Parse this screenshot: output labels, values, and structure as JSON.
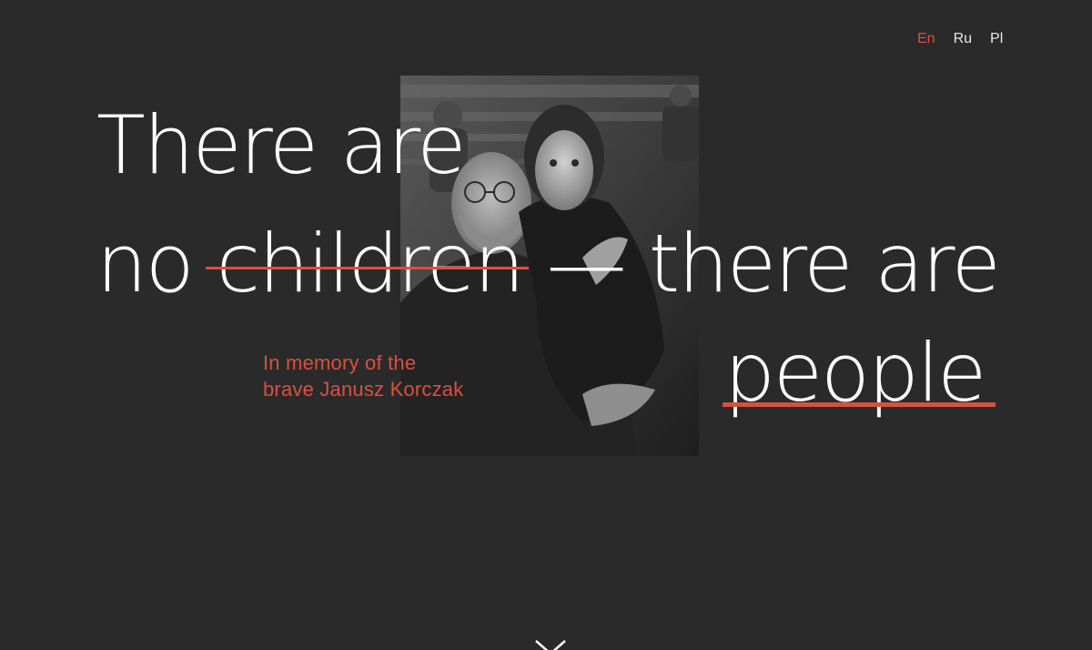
{
  "nav": {
    "languages": [
      {
        "label": "En",
        "active": true
      },
      {
        "label": "Ru",
        "active": false
      },
      {
        "label": "Pl",
        "active": false
      }
    ]
  },
  "hero": {
    "line1": "There are",
    "line2_start": "no ",
    "line2_struck": "children",
    "line2_end": " — there are",
    "line3": "people",
    "subtitle_line1": "In memory of the",
    "subtitle_line2": "brave Janusz Korczak"
  },
  "icons": {
    "scroll": "chevron-down-icon",
    "photo": "photo-korczak-with-child"
  },
  "colors": {
    "background": "#2a2a2b",
    "accent": "#d8513f",
    "text": "#ffffff"
  }
}
